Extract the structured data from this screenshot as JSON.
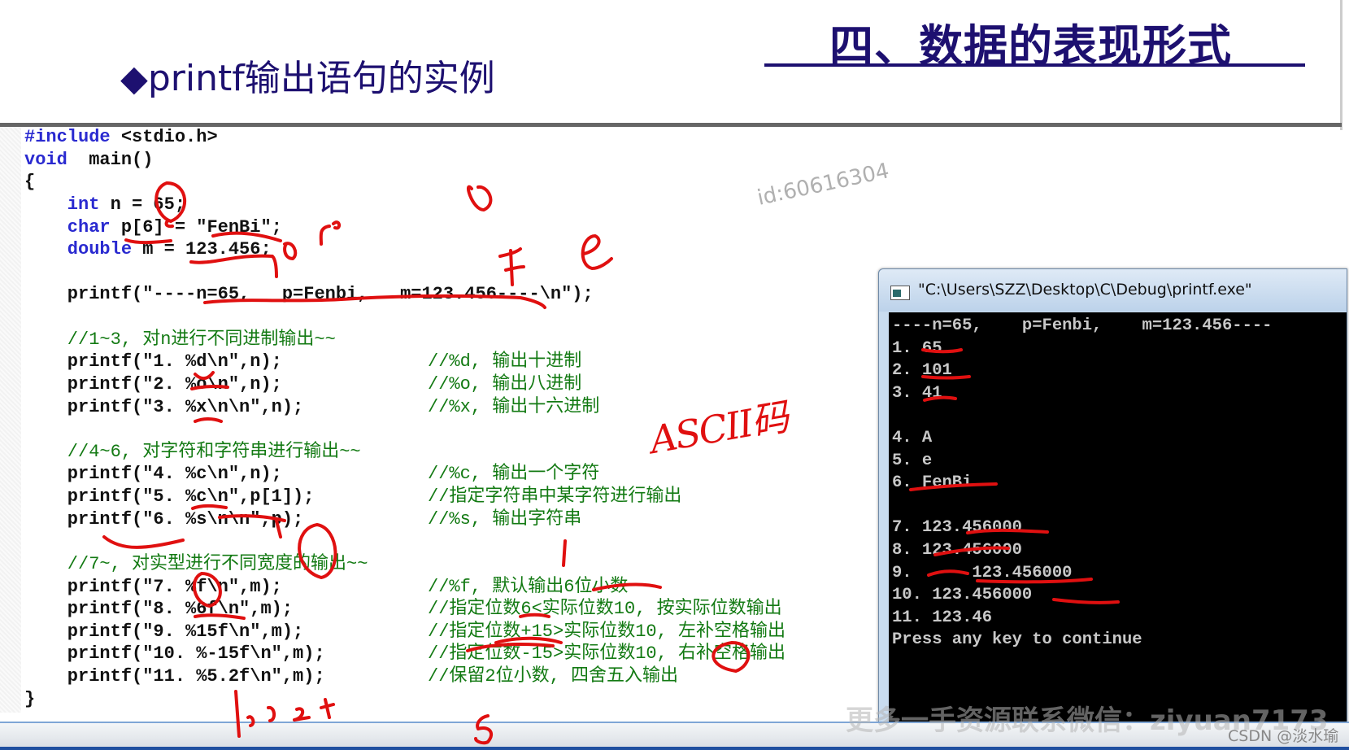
{
  "slide": {
    "title": "四、数据的表现形式",
    "subtitle": "◆printf输出语句的实例",
    "watermark_id": "id:60616304",
    "watermark_wechat": "更多一手资源联系微信：ziyuan7173",
    "watermark_csdn": "CSDN @淡水瑜",
    "annotation_ascii": "ASCII码"
  },
  "code": {
    "lines": [
      {
        "kw": "#include",
        "text": " <stdio.h>",
        "comment": ""
      },
      {
        "kw": "void",
        "text": "  main()",
        "comment": ""
      },
      {
        "kw": "",
        "text": "{",
        "comment": ""
      },
      {
        "kw": "    int",
        "text": " n = 65;",
        "comment": ""
      },
      {
        "kw": "    char",
        "text": " p[6] = \"FenBi\";",
        "comment": ""
      },
      {
        "kw": "    double",
        "text": " m = 123.456;",
        "comment": ""
      },
      {
        "kw": "",
        "text": "",
        "comment": ""
      },
      {
        "kw": "",
        "text": "    printf(\"----n=65,   p=Fenbi,   m=123.456----\\n\");",
        "comment": ""
      },
      {
        "kw": "",
        "text": "",
        "comment": ""
      },
      {
        "kw": "",
        "text": "",
        "section": "    //1~3, 对n进行不同进制输出~~",
        "comment": ""
      },
      {
        "kw": "",
        "text": "    printf(\"1. %d\\n\",n);",
        "comment": "//%d, 输出十进制"
      },
      {
        "kw": "",
        "text": "    printf(\"2. %o\\n\",n);",
        "comment": "//%o, 输出八进制"
      },
      {
        "kw": "",
        "text": "    printf(\"3. %x\\n\\n\",n);",
        "comment": "//%x, 输出十六进制"
      },
      {
        "kw": "",
        "text": "",
        "comment": ""
      },
      {
        "kw": "",
        "text": "",
        "section": "    //4~6, 对字符和字符串进行输出~~",
        "comment": ""
      },
      {
        "kw": "",
        "text": "    printf(\"4. %c\\n\",n);",
        "comment": "//%c, 输出一个字符"
      },
      {
        "kw": "",
        "text": "    printf(\"5. %c\\n\",p[1]);",
        "comment": "//指定字符串中某字符进行输出"
      },
      {
        "kw": "",
        "text": "    printf(\"6. %s\\n\\n\",p);",
        "comment": "//%s, 输出字符串"
      },
      {
        "kw": "",
        "text": "",
        "comment": ""
      },
      {
        "kw": "",
        "text": "",
        "section": "    //7~, 对实型进行不同宽度的输出~~",
        "comment": ""
      },
      {
        "kw": "",
        "text": "    printf(\"7. %f\\n\",m);",
        "comment": "//%f, 默认输出6位小数"
      },
      {
        "kw": "",
        "text": "    printf(\"8. %6f\\n\",m);",
        "comment": "//指定位数6<实际位数10, 按实际位数输出"
      },
      {
        "kw": "",
        "text": "    printf(\"9. %15f\\n\",m);",
        "comment": "//指定位数+15>实际位数10, 左补空格输出"
      },
      {
        "kw": "",
        "text": "    printf(\"10. %-15f\\n\",m);",
        "comment": "//指定位数-15>实际位数10, 右补空格输出"
      },
      {
        "kw": "",
        "text": "    printf(\"11. %5.2f\\n\",m);",
        "comment": "//保留2位小数, 四舍五入输出"
      },
      {
        "kw": "",
        "text": "}",
        "comment": ""
      }
    ]
  },
  "console": {
    "title": "\"C:\\Users\\SZZ\\Desktop\\C\\Debug\\printf.exe\"",
    "lines": [
      "----n=65,    p=Fenbi,    m=123.456----",
      "1. 65",
      "2. 101",
      "3. 41",
      "",
      "4. A",
      "5. e",
      "6. FenBi",
      "",
      "7. 123.456000",
      "8. 123.456000",
      "9.      123.456000",
      "10. 123.456000",
      "11. 123.46",
      "Press any key to continue"
    ]
  },
  "colors": {
    "title": "#1d1070",
    "keyword": "#2a2ad0",
    "comment": "#137a13",
    "annotation": "#e01010",
    "console_bg": "#000000"
  }
}
